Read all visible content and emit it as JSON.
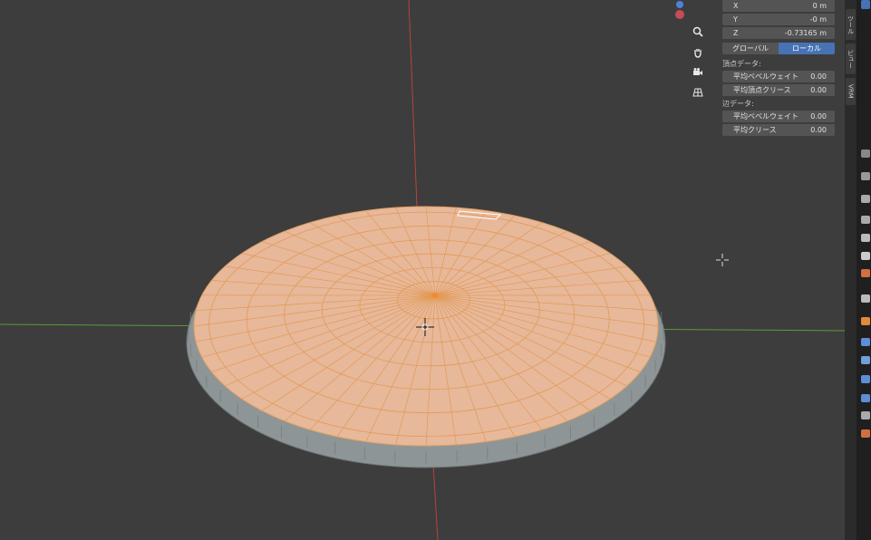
{
  "transform": {
    "fields": [
      {
        "axis": "X",
        "value": "0 m"
      },
      {
        "axis": "Y",
        "value": "-0 m"
      },
      {
        "axis": "Z",
        "value": "-0.73165 m"
      }
    ],
    "space_toggle": {
      "global": "グローバル",
      "local": "ローカル",
      "active": "local"
    }
  },
  "vertex_data": {
    "title": "頂点データ:",
    "fields": [
      {
        "label": "平均ベベルウェイト",
        "value": "0.00"
      },
      {
        "label": "平均頂点クリース",
        "value": "0.00"
      }
    ]
  },
  "edge_data": {
    "title": "辺データ:",
    "fields": [
      {
        "label": "平均ベベルウェイト",
        "value": "0.00"
      },
      {
        "label": "平均クリース",
        "value": "0.00"
      }
    ]
  },
  "side_tabs": [
    "ツール",
    "ビュー",
    "VRM"
  ],
  "nav_icons": [
    "zoom-icon",
    "hand-pan-icon",
    "camera-icon",
    "grid-perspective-icon"
  ],
  "colors": {
    "viewport_bg": "#3d3d3d",
    "selection_orange": "#f0a060",
    "x_axis": "#c0392b",
    "y_axis": "#6aa84f",
    "active_toggle": "#4772b3"
  }
}
